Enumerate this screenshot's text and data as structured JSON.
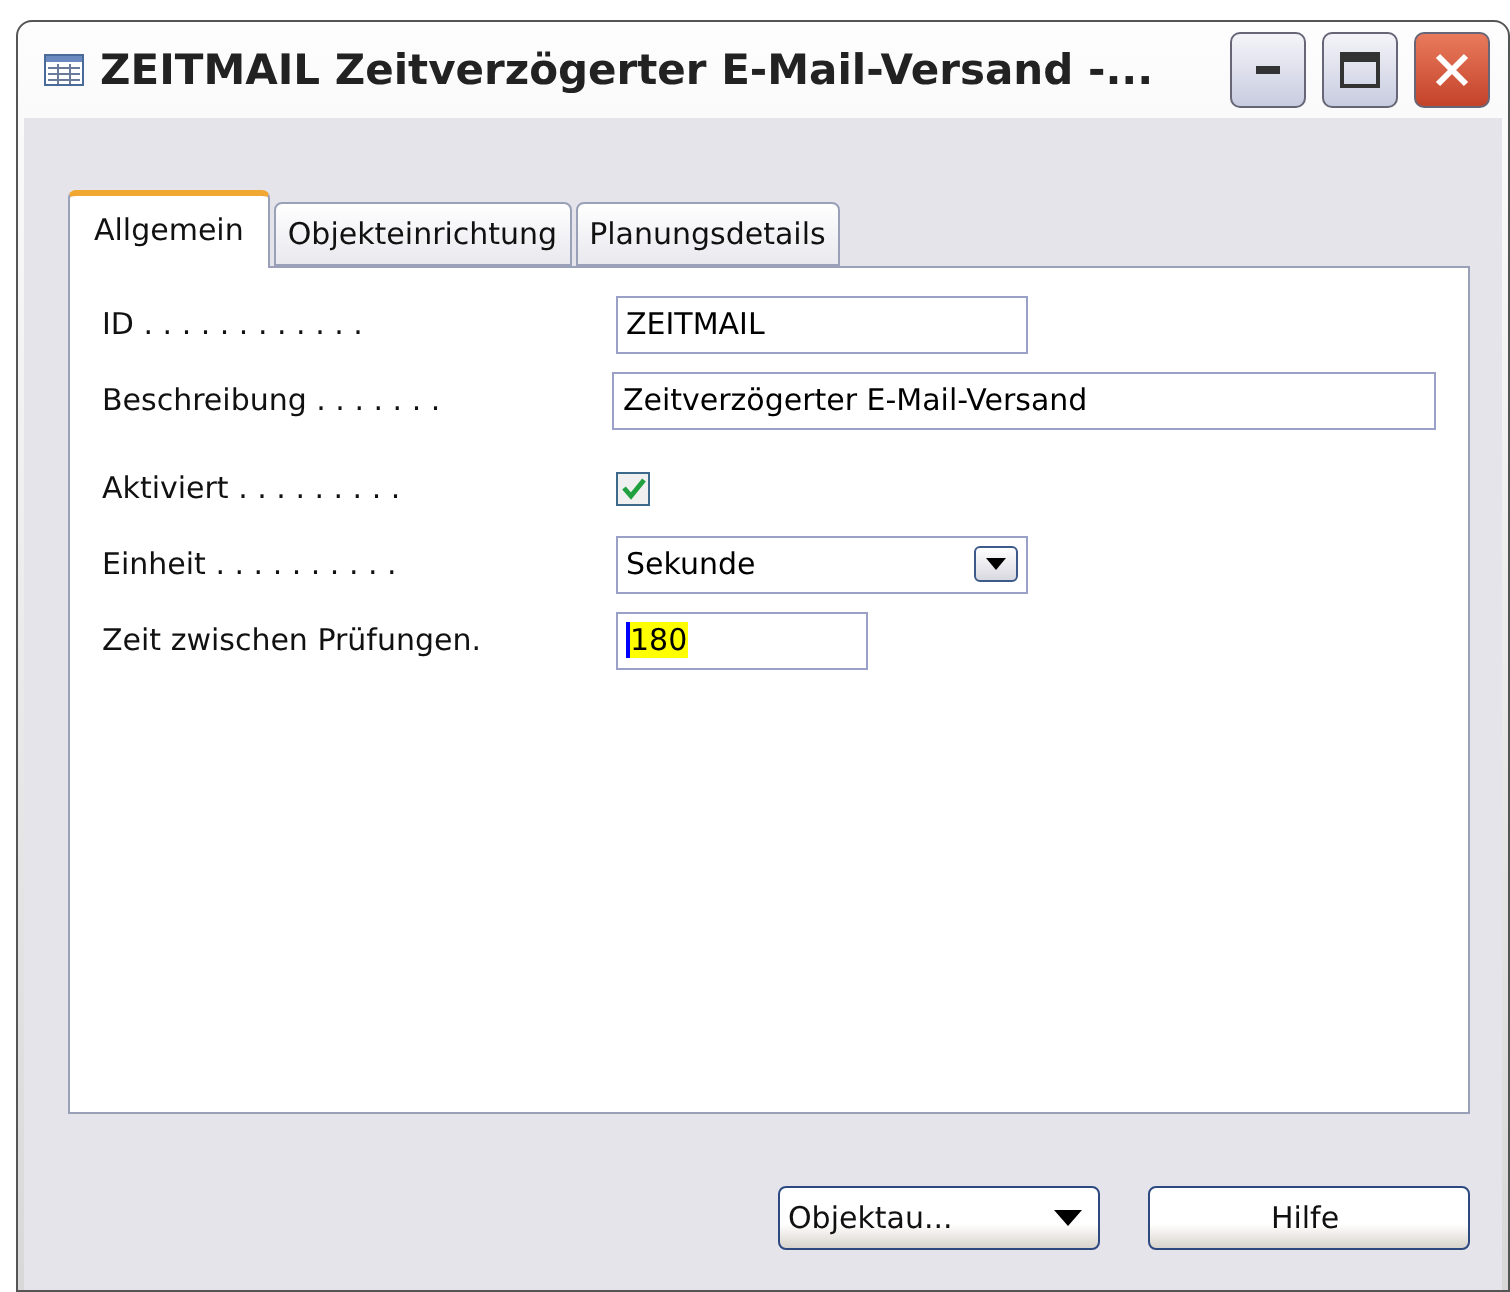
{
  "window": {
    "title": "ZEITMAIL Zeitverzögerter E-Mail-Versand -..."
  },
  "tabs": [
    {
      "label": "Allgemein",
      "selected": true
    },
    {
      "label": "Objekteinrichtung",
      "selected": false
    },
    {
      "label": "Planungsdetails",
      "selected": false
    }
  ],
  "fields": [
    {
      "kind": "text",
      "label": "ID . . . . . . . . . . . .",
      "value": "ZEITMAIL"
    },
    {
      "kind": "wide",
      "label": "Beschreibung . . . . . . .",
      "value": "Zeitverzögerter E-Mail-Versand"
    },
    {
      "kind": "checkbox",
      "label": "Aktiviert . . . . . . . . .",
      "checked": true
    },
    {
      "kind": "select",
      "label": "Einheit . . . . . . . . . .",
      "value": "Sekunde"
    },
    {
      "kind": "number",
      "label": "Zeit zwischen Prüfungen.",
      "value": "180",
      "highlighted": true
    }
  ],
  "buttons": [
    {
      "kind": "menu",
      "label": "Objektau..."
    },
    {
      "kind": "plain",
      "label": "Hilfe"
    }
  ]
}
